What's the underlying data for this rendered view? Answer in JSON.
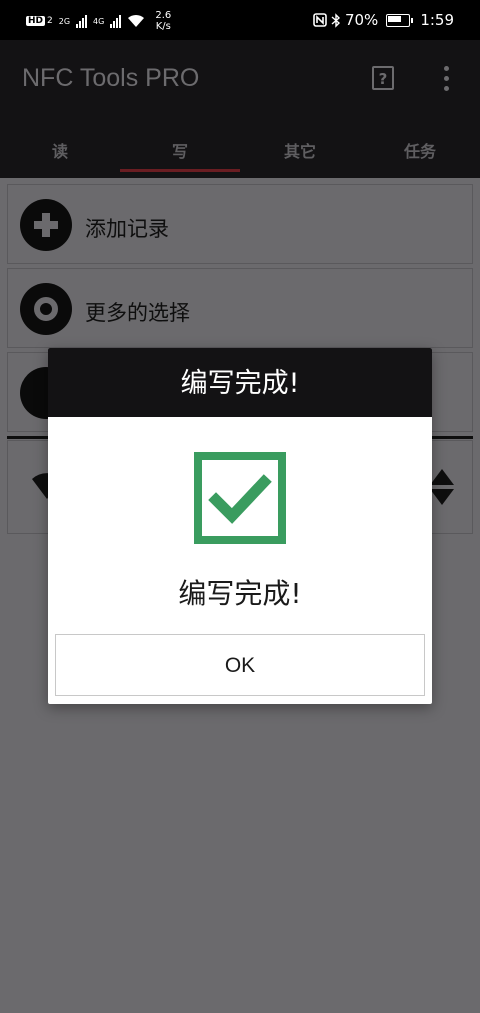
{
  "status_bar": {
    "hd_badge": "HD",
    "sim_index": "2",
    "network_a": "2G",
    "network_b": "4G",
    "speed_value": "2.6",
    "speed_unit": "K/s",
    "battery": "70%",
    "time": "1:59"
  },
  "app_bar": {
    "title": "NFC Tools PRO"
  },
  "tabs": [
    {
      "label": "读",
      "active": false
    },
    {
      "label": "写",
      "active": true
    },
    {
      "label": "其它",
      "active": false
    },
    {
      "label": "任务",
      "active": false
    }
  ],
  "list": {
    "items": [
      {
        "label": "添加记录",
        "icon": "plus-icon"
      },
      {
        "label": "更多的选择",
        "icon": "wrench-icon"
      }
    ]
  },
  "dialog": {
    "title": "编写完成!",
    "message": "编写完成!",
    "ok_label": "OK",
    "check_color": "#3a9c5f"
  }
}
